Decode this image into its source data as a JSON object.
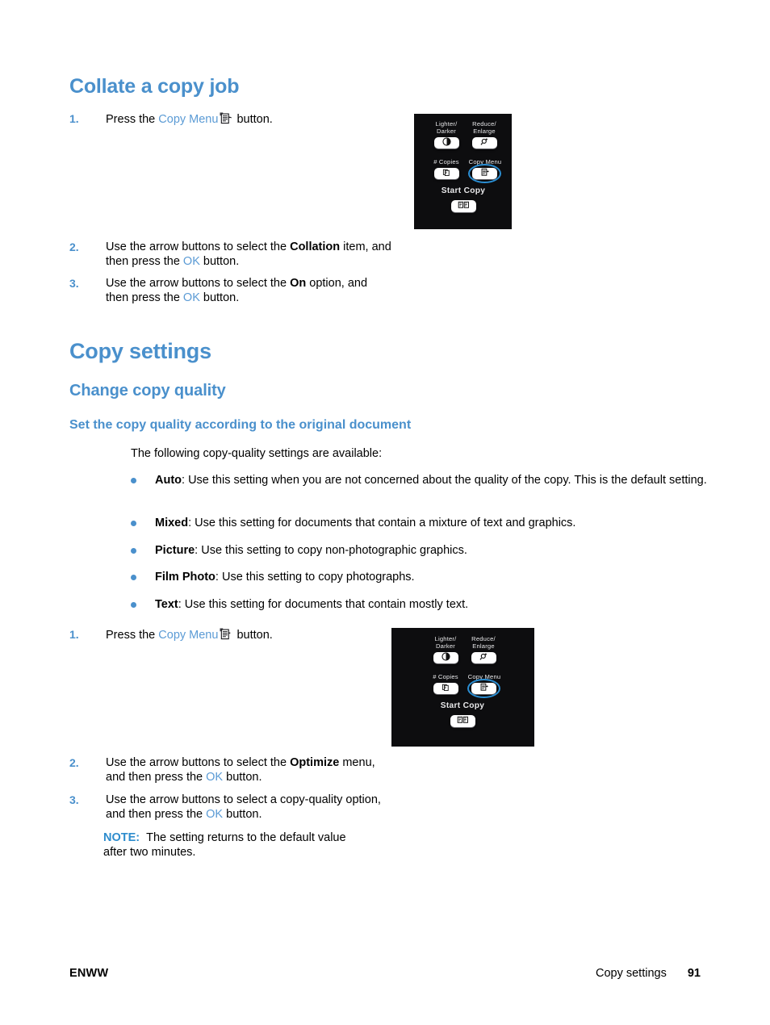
{
  "sections": [
    {
      "heading": "Collate a copy job",
      "level": "h1"
    }
  ],
  "collate": {
    "title": "Collate a copy job",
    "step1": {
      "num": "1.",
      "pre": "Press the ",
      "link": "Copy Menu",
      "icon": "copy-menu-icon",
      "post": " button."
    },
    "step2": {
      "num": "2.",
      "pre": "Use the arrow buttons to select the ",
      "bold": "Collation",
      "mid": " item, and then press the ",
      "link": "OK",
      "post": " button."
    },
    "step3": {
      "num": "3.",
      "pre": "Use the arrow buttons to select the ",
      "bold": "On",
      "mid": " option, and then press the ",
      "link": "OK",
      "post": " button."
    }
  },
  "copy_settings": {
    "title": "Copy settings",
    "subtitle": "Change copy quality",
    "subsubtitle": "Set the copy quality according to the original document",
    "intro": "The following copy-quality settings are available:",
    "options": [
      {
        "name": "Auto",
        "desc": ": Use this setting when you are not concerned about the quality of the copy. This is the default setting."
      },
      {
        "name": "Mixed",
        "desc": ": Use this setting for documents that contain a mixture of text and graphics."
      },
      {
        "name": "Picture",
        "desc": ": Use this setting to copy non-photographic graphics."
      },
      {
        "name": "Film Photo",
        "desc": ": Use this setting to copy photographs."
      },
      {
        "name": "Text",
        "desc": ": Use this setting for documents that contain mostly text."
      }
    ],
    "step1": {
      "num": "1.",
      "pre": "Press the ",
      "link": "Copy Menu",
      "icon": "copy-menu-icon",
      "post": " button."
    },
    "step2": {
      "num": "2.",
      "pre": "Use the arrow buttons to select the ",
      "bold": "Optimize",
      "mid": " menu, and then press the ",
      "link": "OK",
      "post": " button."
    },
    "step3": {
      "num": "3.",
      "pre": "Use the arrow buttons to select a copy-quality option, and then press the ",
      "link": "OK",
      "post": " button."
    },
    "note": {
      "label": "NOTE:",
      "text": "The setting returns to the default value after two minutes."
    }
  },
  "control_panel": {
    "buttons": [
      {
        "label_line1": "Lighter/",
        "label_line2": "Darker",
        "icon": "contrast-circle-icon"
      },
      {
        "label_line1": "Reduce/",
        "label_line2": "Enlarge",
        "icon": "magnifier-plus-icon"
      },
      {
        "label_line1": "# Copies",
        "label_line2": "",
        "icon": "stacked-pages-icon"
      },
      {
        "label_line1": "Copy Menu",
        "label_line2": "",
        "icon": "copy-menu-icon",
        "highlighted": true
      },
      {
        "label_line1": "Start Copy",
        "label_line2": "",
        "icon": "start-copy-icon"
      }
    ],
    "highlight_color": "#2b8fd4",
    "background_color": "#0d0d0f"
  },
  "footer": {
    "left": "ENWW",
    "section": "Copy settings",
    "page": "91"
  },
  "colors": {
    "heading_blue": "#4a90cc",
    "link_blue": "#5b9bd5",
    "note_blue": "#2d8ccd",
    "bullet_blue": "#4a90cc"
  }
}
